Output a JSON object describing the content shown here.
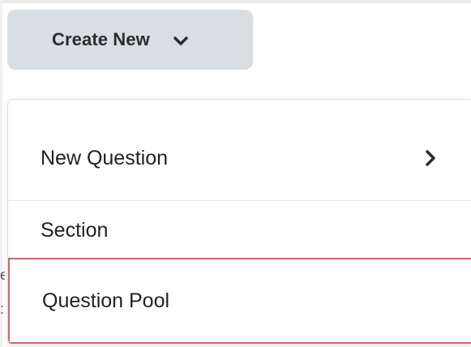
{
  "toolbar": {
    "create_new_label": "Create New",
    "create_new_icon": "chevron-down-icon"
  },
  "menu": {
    "items": [
      {
        "label": "New Question",
        "icon": "chevron-right-icon",
        "has_submenu": true
      },
      {
        "label": "Section"
      },
      {
        "label": "Question Pool",
        "highlighted": true
      }
    ]
  },
  "colors": {
    "button_bg": "#d9dee3",
    "highlight_border": "#d9606b",
    "text": "#1f2124"
  }
}
